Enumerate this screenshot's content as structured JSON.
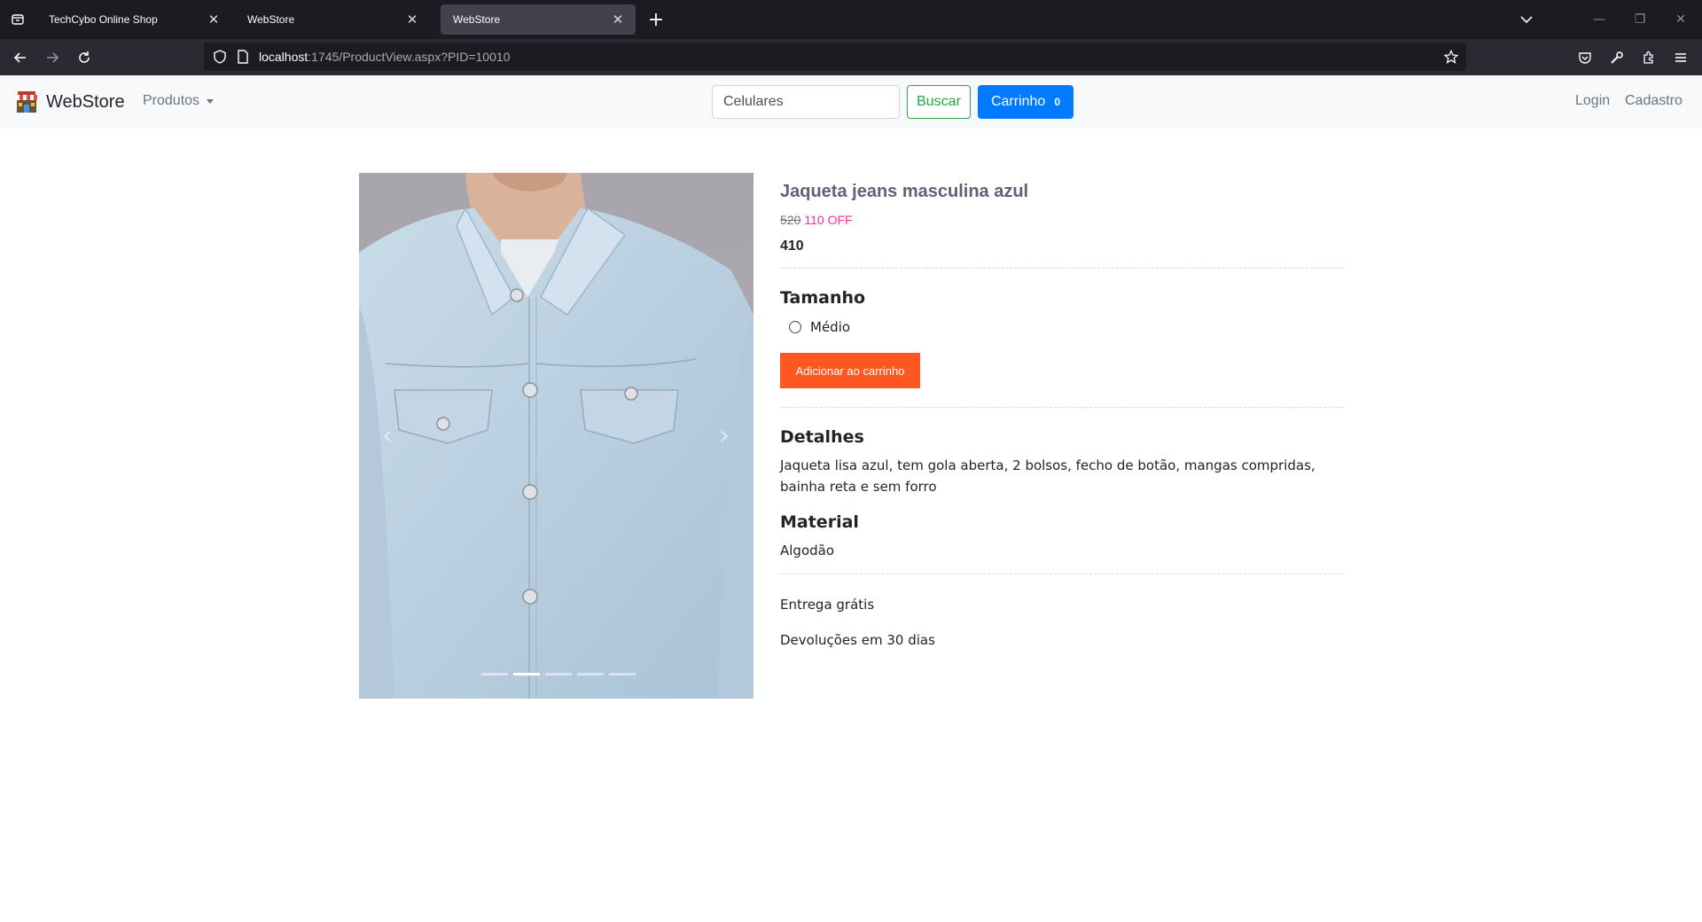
{
  "browser": {
    "tabs": [
      {
        "title": "TechCybo Online Shop",
        "active": false
      },
      {
        "title": "WebStore",
        "active": false
      },
      {
        "title": "WebStore",
        "active": true
      }
    ],
    "url_host": "localhost",
    "url_rest": ":1745/ProductView.aspx?PID=10010"
  },
  "site": {
    "brand": "WebStore",
    "products_menu": "Produtos",
    "search_placeholder": "Celulares",
    "search_button": "Buscar",
    "cart_label": "Carrinho",
    "cart_count": "0",
    "login": "Login",
    "signup": "Cadastro"
  },
  "product": {
    "title": "Jaqueta jeans masculina azul",
    "old_price": "520",
    "discount": "110 OFF",
    "price": "410",
    "size_heading": "Tamanho",
    "size_option": "Médio",
    "add_to_cart": "Adicionar ao carrinho",
    "details_heading": "Detalhes",
    "details_text": "Jaqueta lisa azul, tem gola aberta, 2 bolsos, fecho de botão, mangas compridas, bainha reta e sem forro",
    "material_heading": "Material",
    "material_text": "Algodão",
    "delivery": "Entrega grátis",
    "returns": "Devoluções em 30 dias",
    "carousel_active_slide": 2,
    "carousel_slide_count": 5
  },
  "colors": {
    "accent_primary": "#007bff",
    "accent_success": "#28a745",
    "add_to_cart": "#ff5722",
    "discount": "#ff2f8f"
  }
}
